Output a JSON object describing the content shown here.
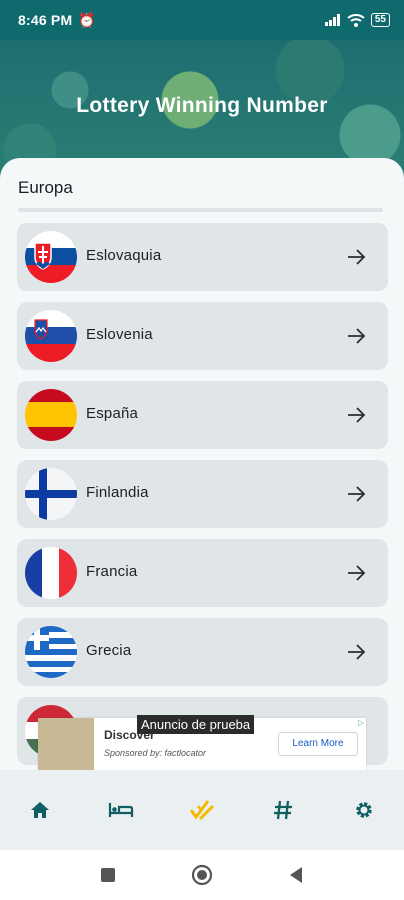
{
  "status_bar": {
    "time": "8:46 PM",
    "battery": "55"
  },
  "header": {
    "title": "Lottery Winning Number"
  },
  "section": {
    "title": "Europa"
  },
  "countries": [
    {
      "name": "Eslovaquia",
      "flag": "slovakia-flag-icon"
    },
    {
      "name": "Eslovenia",
      "flag": "slovenia-flag-icon"
    },
    {
      "name": "España",
      "flag": "spain-flag-icon"
    },
    {
      "name": "Finlandia",
      "flag": "finland-flag-icon"
    },
    {
      "name": "Francia",
      "flag": "france-flag-icon"
    },
    {
      "name": "Grecia",
      "flag": "greece-flag-icon"
    }
  ],
  "ad": {
    "label": "Anuncio de prueba",
    "headline": "Discover",
    "sponsor": "Sponsored by: factlocator",
    "cta": "Learn More"
  },
  "bottom_nav": [
    {
      "icon": "home-icon"
    },
    {
      "icon": "bed-icon"
    },
    {
      "icon": "ticket-check-icon",
      "active": true
    },
    {
      "icon": "hash-icon"
    },
    {
      "icon": "gear-icon"
    }
  ],
  "colors": {
    "primary": "#0f6a6e",
    "accent": "#f5b800",
    "card": "#e0e5e8"
  }
}
